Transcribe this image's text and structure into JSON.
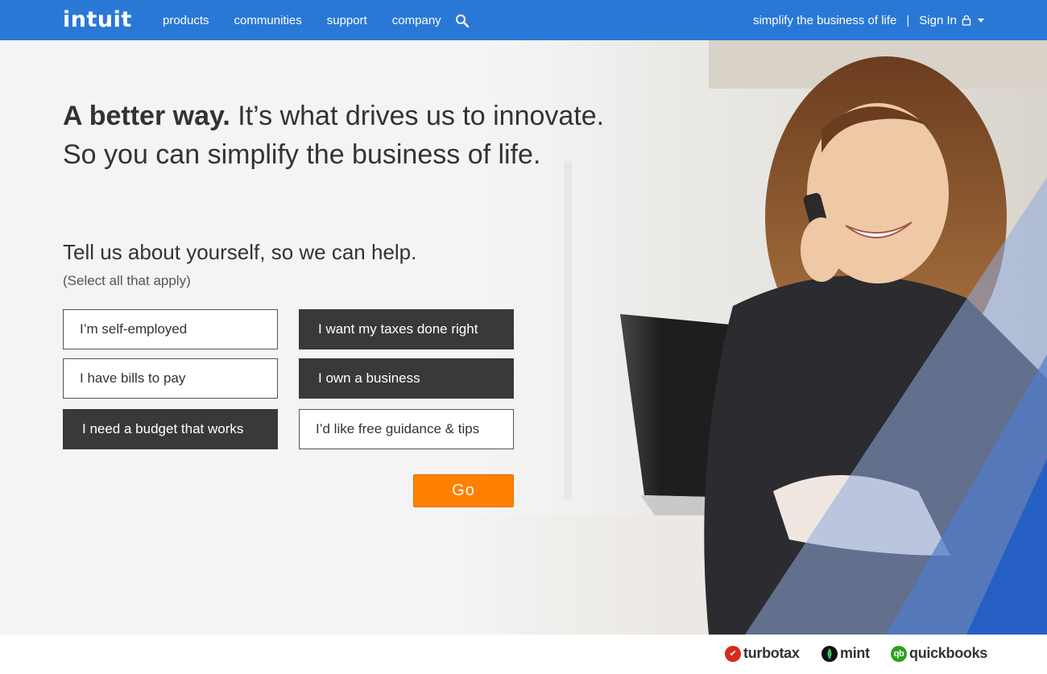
{
  "header": {
    "logo": "intuit",
    "nav": [
      "products",
      "communities",
      "support",
      "company"
    ],
    "tagline": "simplify the business of life",
    "separator": "|",
    "signin_label": "Sign In"
  },
  "hero": {
    "headline_bold": "A better way.",
    "headline_rest": " It’s what drives us to innovate.",
    "headline_line2": "So you can simplify the business of life.",
    "question": "Tell us about yourself, so we can help.",
    "question_note": "(Select all that apply)",
    "options": [
      {
        "label": "I’m self-employed",
        "selected": false
      },
      {
        "label": "I want my taxes done right",
        "selected": true
      },
      {
        "label": "I have bills to pay",
        "selected": false
      },
      {
        "label": "I own a business",
        "selected": true
      },
      {
        "label": "I need a budget that works",
        "selected": true
      },
      {
        "label": "I’d like free guidance & tips",
        "selected": false
      }
    ],
    "go_label": "Go"
  },
  "footer": {
    "brands": [
      "turbotax",
      "mint",
      "quickbooks"
    ],
    "brand_colors": {
      "turbotax": "#d52b1e",
      "mint": "#0f7a3a",
      "quickbooks": "#2ca01c"
    }
  },
  "colors": {
    "nav_bg": "#2a78d6",
    "accent": "#ff8000",
    "dark_button": "#393939"
  }
}
